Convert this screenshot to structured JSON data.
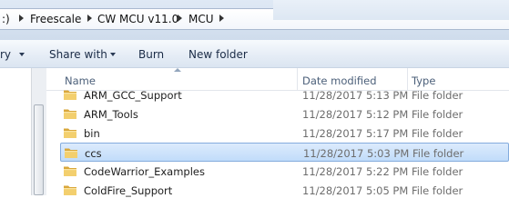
{
  "breadcrumb": {
    "items": [
      ":)",
      "Freescale",
      "CW MCU v11.0",
      "MCU"
    ]
  },
  "toolbar": {
    "organize_label": "ry",
    "share_label": "Share with",
    "burn_label": "Burn",
    "new_folder_label": "New folder"
  },
  "columns": {
    "name": "Name",
    "date": "Date modified",
    "type": "Type"
  },
  "files": [
    {
      "name": "ARM_GCC_Support",
      "date": "11/28/2017 5:13 PM",
      "type": "File folder",
      "selected": false
    },
    {
      "name": "ARM_Tools",
      "date": "11/28/2017 5:12 PM",
      "type": "File folder",
      "selected": false
    },
    {
      "name": "bin",
      "date": "11/28/2017 5:17 PM",
      "type": "File folder",
      "selected": false
    },
    {
      "name": "ccs",
      "date": "11/28/2017 5:03 PM",
      "type": "File folder",
      "selected": true
    },
    {
      "name": "CodeWarrior_Examples",
      "date": "11/28/2017 5:22 PM",
      "type": "File folder",
      "selected": false
    },
    {
      "name": "ColdFire_Support",
      "date": "11/28/2017 5:05 PM",
      "type": "File folder",
      "selected": false
    }
  ],
  "icons": {
    "folder": "folder-icon",
    "breadcrumb_separator": "chevron-right-icon",
    "dropdown": "chevron-down-icon",
    "sort": "sort-ascending-icon"
  },
  "colors": {
    "selection_fill": "#cce4f9",
    "selection_border": "#84acdd",
    "folder": "#e9c46a"
  }
}
